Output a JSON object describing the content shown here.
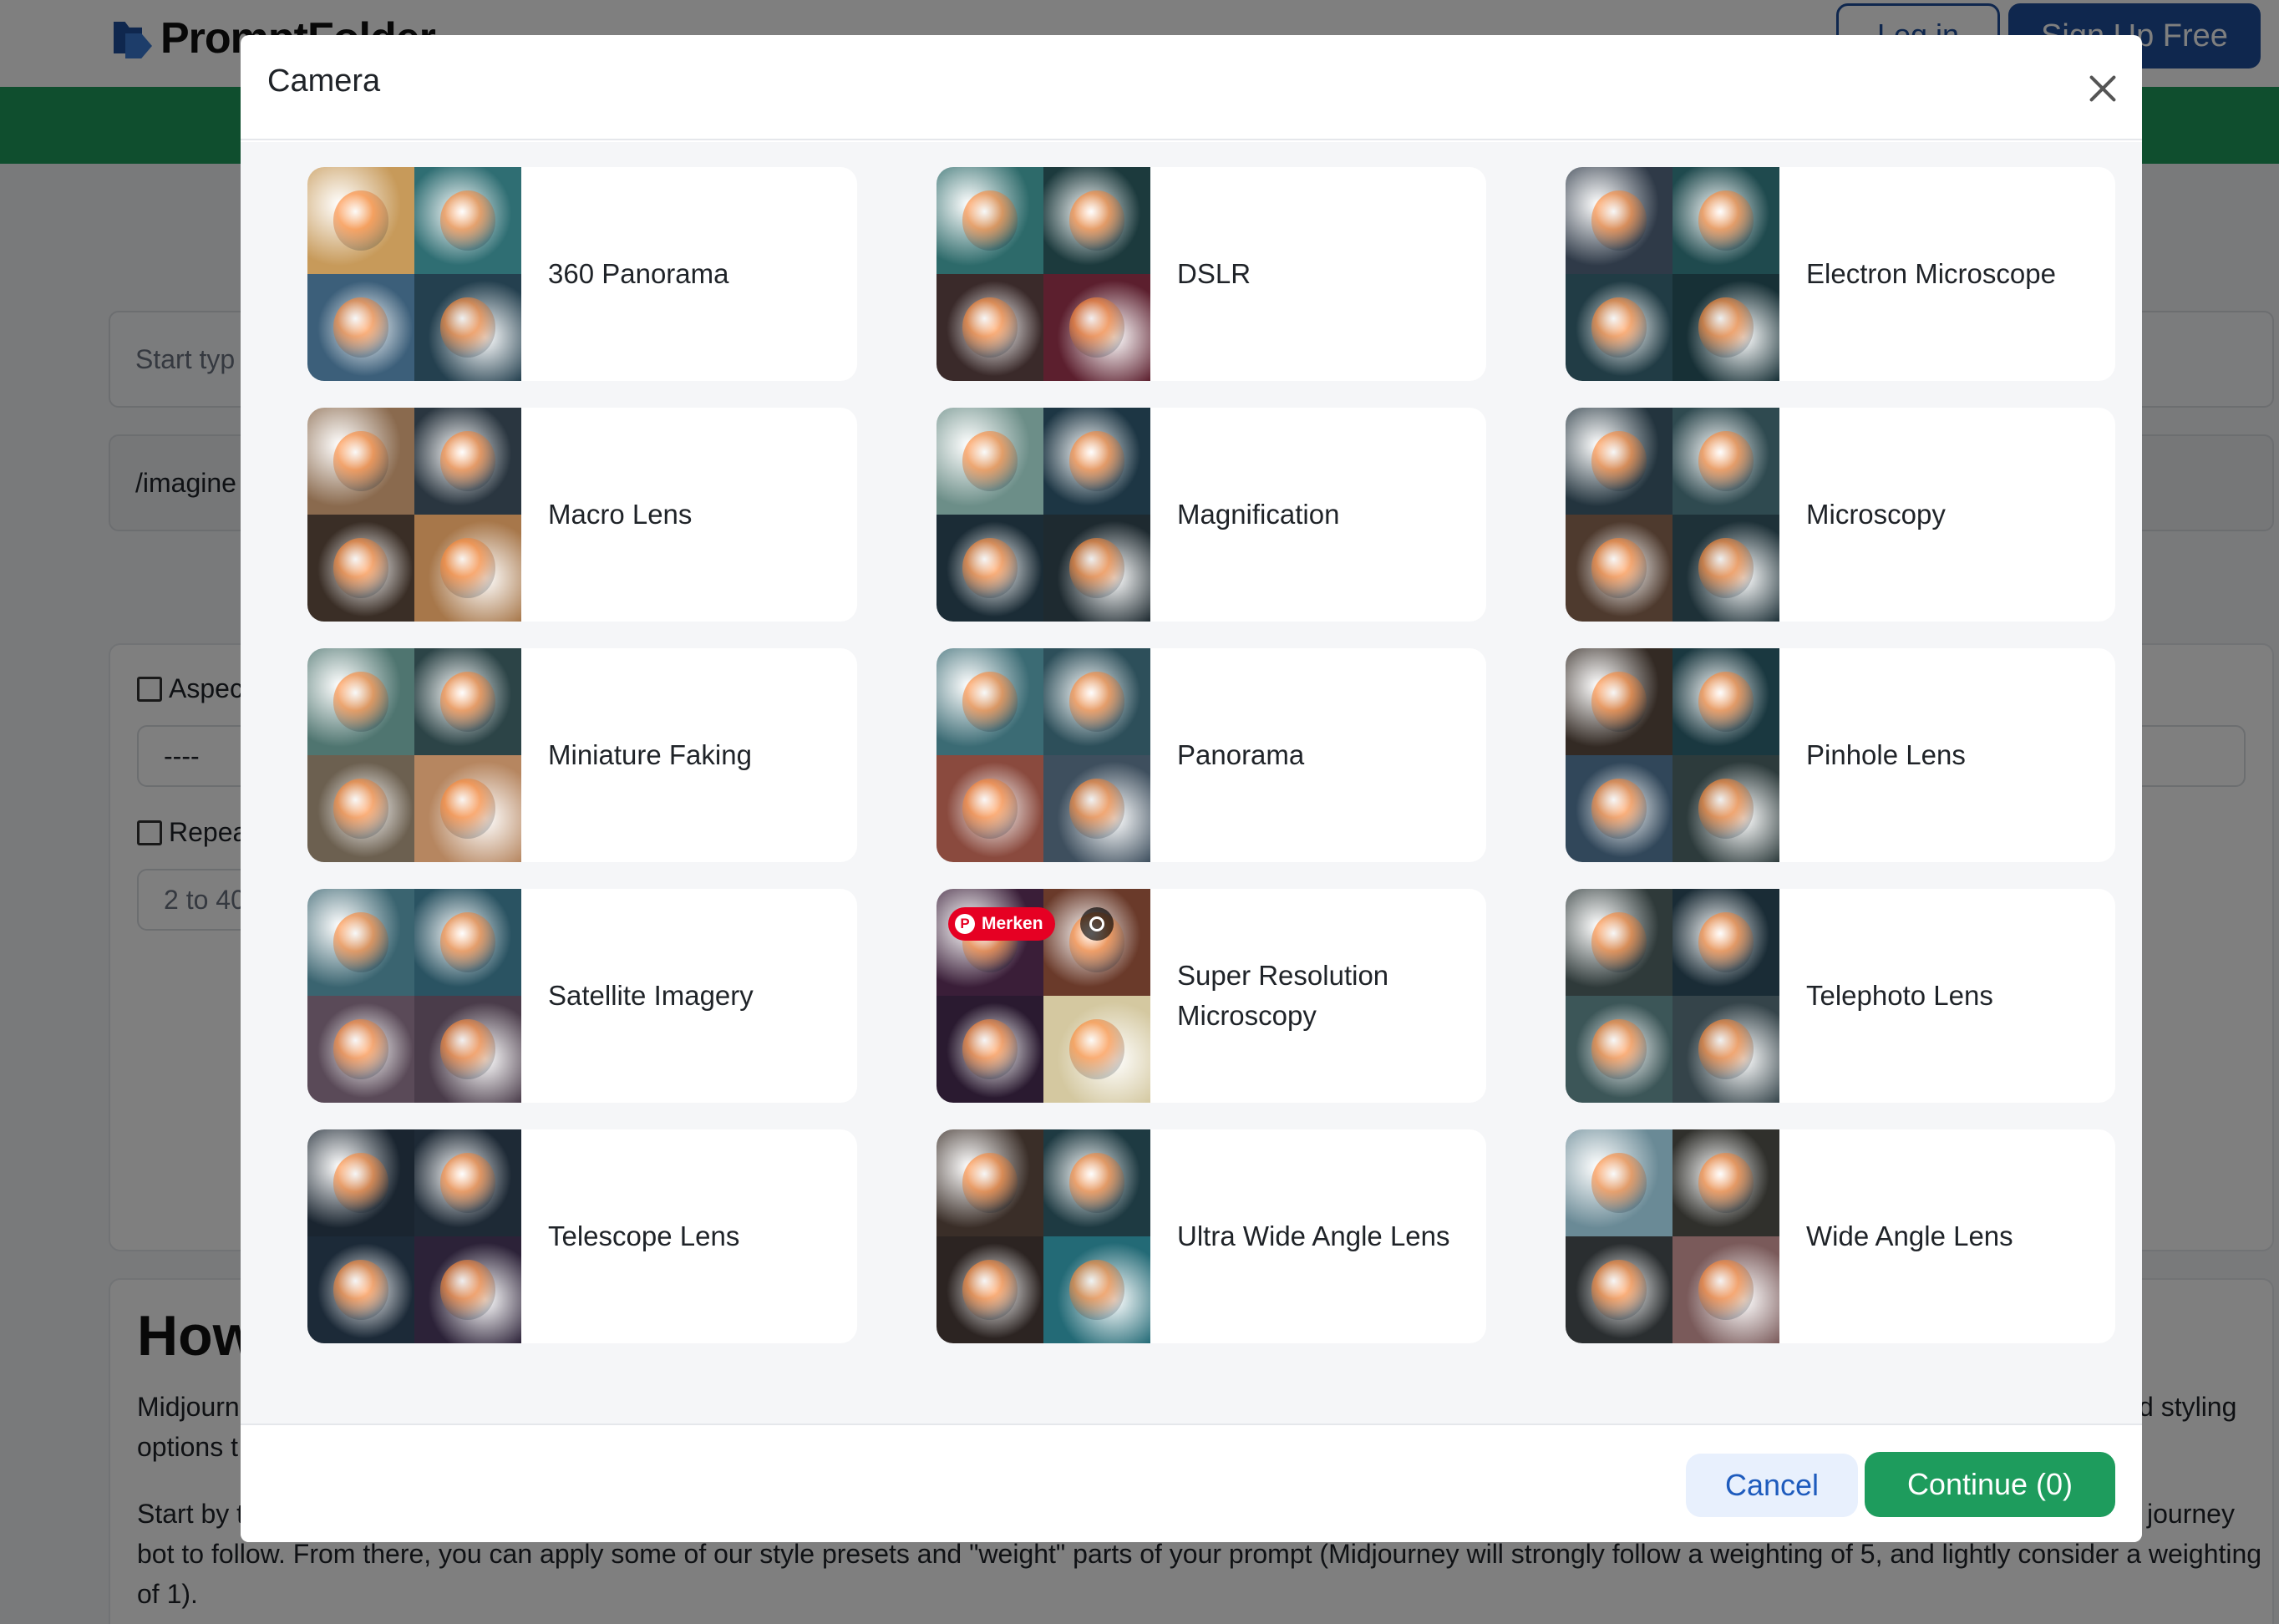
{
  "header": {
    "logo_text": "PromptFolder",
    "login_label": "Log in",
    "signup_label": "Sign Up Free"
  },
  "background": {
    "prompt_placeholder": "Start typ",
    "imagine_text": "/imagine",
    "aspect_label": "Aspec",
    "aspect_value": "----",
    "repeat_label": "Repea",
    "repeat_placeholder": "2 to 40",
    "how_title": "How",
    "how_line1_left": "Midjourn",
    "how_line1_right": "d styling",
    "how_line2_left": "options t",
    "how_line3_left": "Start by t",
    "how_line3_right": "journey",
    "how_line4": "bot to follow. From there, you can apply some of our style presets and \"weight\" parts of your prompt (Midjourney will strongly follow a weighting of 5, and lightly consider a weighting",
    "how_line5": "of 1)."
  },
  "modal": {
    "title": "Camera",
    "close_icon": "close-icon",
    "options": [
      {
        "label": "360 Panorama",
        "colors": [
          "#c79a5a",
          "#2f6e73",
          "#3c5f7a",
          "#24404f"
        ]
      },
      {
        "label": "DSLR",
        "colors": [
          "#2d6a6a",
          "#1c3a3d",
          "#3a2a2a",
          "#5c1f2e"
        ]
      },
      {
        "label": "Electron Microscope",
        "colors": [
          "#2f3a48",
          "#1f4a4e",
          "#213c45",
          "#173036"
        ]
      },
      {
        "label": "Macro Lens",
        "colors": [
          "#8a6a4e",
          "#2a3640",
          "#3a2e26",
          "#a7774a"
        ]
      },
      {
        "label": "Magnification",
        "colors": [
          "#6c8e88",
          "#1d3644",
          "#1b2c36",
          "#1e2a30"
        ]
      },
      {
        "label": "Microscopy",
        "colors": [
          "#23343e",
          "#2f4a50",
          "#4e3a2e",
          "#1e3138"
        ]
      },
      {
        "label": "Miniature Faking",
        "colors": [
          "#4f7570",
          "#2c4447",
          "#6c6050",
          "#b68660"
        ]
      },
      {
        "label": "Panorama",
        "colors": [
          "#3b6b74",
          "#2d4f5a",
          "#8a4a3e",
          "#3e4f5e"
        ]
      },
      {
        "label": "Pinhole Lens",
        "colors": [
          "#332a24",
          "#1a3840",
          "#31475a",
          "#2d3b3c"
        ]
      },
      {
        "label": "Satellite Imagery",
        "colors": [
          "#3a6470",
          "#2a5362",
          "#5a4a58",
          "#4a3c4a"
        ]
      },
      {
        "label": "Super Resolution Microscopy",
        "colors": [
          "#3a1e38",
          "#6a3a2a",
          "#2a1a30",
          "#d4c8a0"
        ],
        "pinterest_badge": "Merken"
      },
      {
        "label": "Telephoto Lens",
        "colors": [
          "#2f3a3a",
          "#1a2c36",
          "#3c5658",
          "#35444a"
        ]
      },
      {
        "label": "Telescope Lens",
        "colors": [
          "#1a2530",
          "#1e2a36",
          "#1c2a38",
          "#2c2238"
        ]
      },
      {
        "label": "Ultra Wide Angle Lens",
        "colors": [
          "#3a2e28",
          "#1e3a42",
          "#2c2422",
          "#236a76"
        ]
      },
      {
        "label": "Wide Angle Lens",
        "colors": [
          "#6a8a96",
          "#30302c",
          "#2a2e30",
          "#7a5a5a"
        ]
      }
    ],
    "cancel_label": "Cancel",
    "continue_label": "Continue (0)"
  }
}
